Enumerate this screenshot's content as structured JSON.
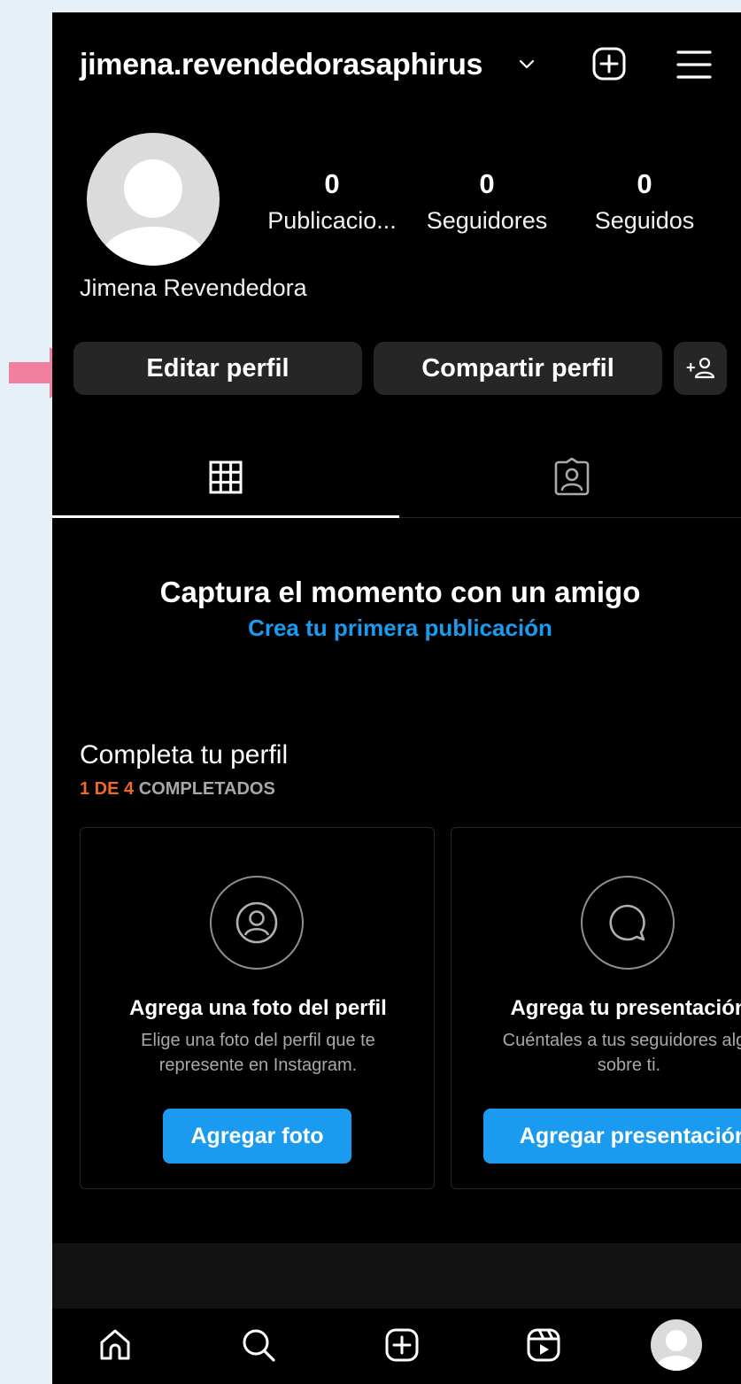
{
  "header": {
    "username": "jimena.revendedorasaphirus"
  },
  "profile": {
    "full_name": "Jimena Revendedora",
    "stats": [
      {
        "count": "0",
        "label": "Publicacio..."
      },
      {
        "count": "0",
        "label": "Seguidores"
      },
      {
        "count": "0",
        "label": "Seguidos"
      }
    ]
  },
  "actions": {
    "edit_label": "Editar perfil",
    "share_label": "Compartir perfil",
    "add_person_label": "+"
  },
  "empty_state": {
    "title": "Captura el momento con un amigo",
    "link": "Crea tu primera publicación"
  },
  "complete_profile": {
    "title": "Completa tu perfil",
    "progress_accent": "1 DE 4",
    "progress_rest": " COMPLETADOS",
    "cards": [
      {
        "title": "Agrega una foto del perfil",
        "description": "Elige una foto del perfil que te represente en Instagram.",
        "button": "Agregar foto"
      },
      {
        "title": "Agrega tu presentación",
        "description": "Cuéntales a tus seguidores algo sobre ti.",
        "button": "Agregar presentación"
      }
    ]
  },
  "colors": {
    "background": "#000000",
    "button_bg": "#262626",
    "accent_blue": "#1a9bf0",
    "accent_orange": "#f06a27",
    "pointer_arrow": "#f07fa0",
    "page_bg": "#e6f0f8"
  },
  "icons": {
    "pointer": "arrow-right-icon",
    "chevron": "chevron-down-icon",
    "create": "plus-square-icon",
    "menu": "hamburger-menu-icon",
    "add_person": "add-person-icon",
    "grid_tab": "grid-icon",
    "tagged_tab": "tagged-person-icon",
    "card1_icon": "user-circle-icon",
    "card2_icon": "chat-bubble-icon",
    "nav": [
      "home-icon",
      "search-icon",
      "plus-square-icon",
      "reels-icon",
      "profile-avatar"
    ]
  }
}
